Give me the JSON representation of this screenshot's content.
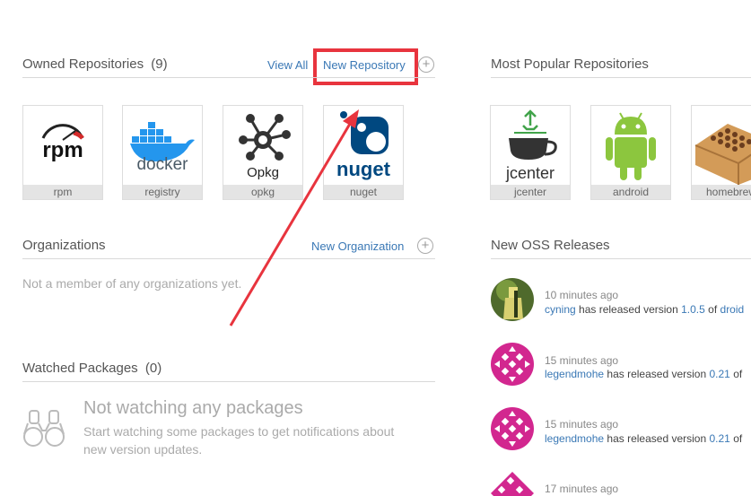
{
  "owned": {
    "title": "Owned Repositories",
    "count": "(9)",
    "view_all": "View All",
    "new_repo": "New Repository",
    "repos": [
      {
        "name": "rpm",
        "logo_text": "rpm"
      },
      {
        "name": "registry",
        "logo_text": "docker"
      },
      {
        "name": "opkg",
        "logo_text": "Opkg"
      },
      {
        "name": "nuget",
        "logo_text": "nuget"
      }
    ]
  },
  "orgs": {
    "title": "Organizations",
    "new_org": "New Organization",
    "empty": "Not a member of any organizations yet."
  },
  "watched": {
    "title": "Watched Packages",
    "count": "(0)",
    "empty_title": "Not watching any packages",
    "empty_desc_line1": "Start watching some packages to get notifications about",
    "empty_desc_line2": "new version updates."
  },
  "popular": {
    "title": "Most Popular Repositories",
    "repos": [
      {
        "name": "jcenter",
        "logo_text": "jcenter"
      },
      {
        "name": "android",
        "logo_text": ""
      },
      {
        "name": "homebrew",
        "logo_text": ""
      }
    ]
  },
  "releases": {
    "title": "New OSS Releases",
    "items": [
      {
        "time": "10 minutes ago",
        "user": "cyning",
        "middle": "has released version",
        "version": "1.0.5",
        "of": "of",
        "package": "droid"
      },
      {
        "time": "15 minutes ago",
        "user": "legendmohe",
        "middle": "has released version",
        "version": "0.21",
        "of": "of",
        "package": ""
      },
      {
        "time": "15 minutes ago",
        "user": "legendmohe",
        "middle": "has released version",
        "version": "0.21",
        "of": "of",
        "package": ""
      },
      {
        "time": "17 minutes ago",
        "user": "",
        "middle": "",
        "version": "",
        "of": "",
        "package": ""
      }
    ]
  },
  "colors": {
    "link": "#3a78b5",
    "highlight_box": "#e8343e",
    "arrow": "#e8343e",
    "nuget_blue": "#004880",
    "docker_blue": "#2496ed",
    "android_green": "#8cc63e",
    "jcenter_green": "#41a34a"
  }
}
